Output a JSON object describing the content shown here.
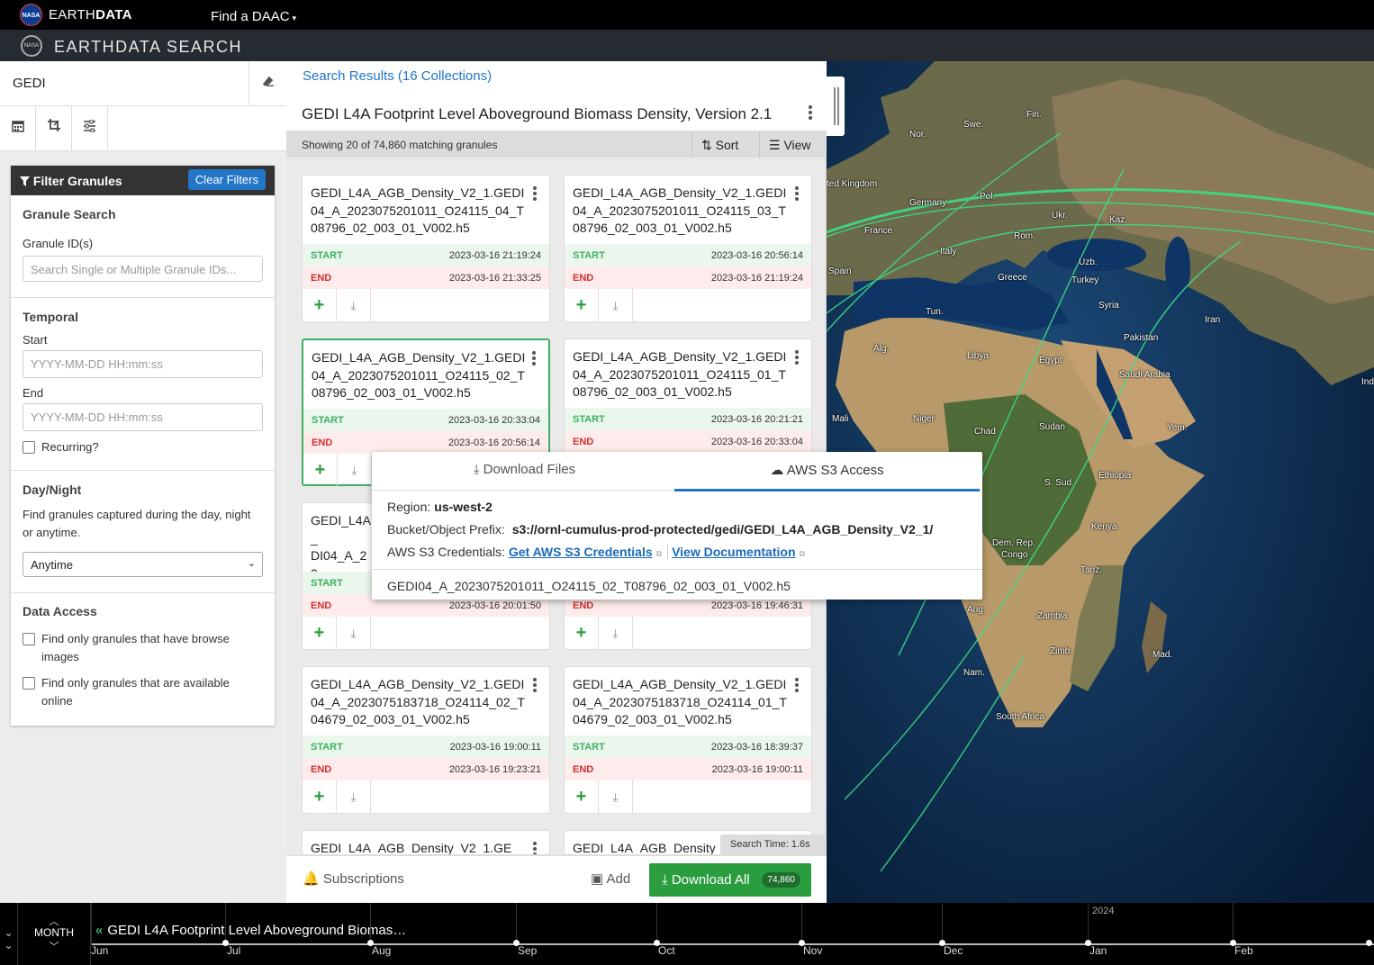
{
  "topbar": {
    "nasa_logo": "NASA",
    "earth": "EARTH",
    "data": "DATA",
    "find_daac": "Find a DAAC",
    "caret": "▾"
  },
  "appbar": {
    "logo": "NASA",
    "title": "EARTHDATA SEARCH"
  },
  "search": {
    "query": "GEDI",
    "clear_icon": "eraser-icon"
  },
  "sidebar_icons": [
    "calendar-icon",
    "crop-icon",
    "sliders-icon"
  ],
  "filter": {
    "header": "Filter Granules",
    "clear": "Clear Filters",
    "granule_search": {
      "title": "Granule Search",
      "label": "Granule ID(s)",
      "placeholder": "Search Single or Multiple Granule IDs..."
    },
    "temporal": {
      "title": "Temporal",
      "start_label": "Start",
      "start_placeholder": "YYYY-MM-DD HH:mm:ss",
      "end_label": "End",
      "end_placeholder": "YYYY-MM-DD HH:mm:ss",
      "recurring": "Recurring?"
    },
    "daynight": {
      "title": "Day/Night",
      "desc": "Find granules captured during the day, night or anytime.",
      "selected": "Anytime"
    },
    "access": {
      "title": "Data Access",
      "browse": "Find only granules that have browse images",
      "online": "Find only granules that are available online"
    }
  },
  "results": {
    "link": "Search Results (16 Collections)",
    "collection_title": "GEDI L4A Footprint Level Aboveground Biomass Density, Version 2.1",
    "showing": "Showing 20 of 74,860 matching granules",
    "sort": "Sort",
    "view": "View",
    "start_label": "START",
    "end_label": "END",
    "granules": [
      {
        "name": "GEDI_L4A_AGB_Density_V2_1.GEDI04_A_2023075201011_O24115_04_T08796_02_003_01_V002.h5",
        "start": "2023-03-16 21:19:24",
        "end": "2023-03-16 21:33:25"
      },
      {
        "name": "GEDI_L4A_AGB_Density_V2_1.GEDI04_A_2023075201011_O24115_03_T08796_02_003_01_V002.h5",
        "start": "2023-03-16 20:56:14",
        "end": "2023-03-16 21:19:24"
      },
      {
        "name": "GEDI_L4A_AGB_Density_V2_1.GEDI04_A_2023075201011_O24115_02_T08796_02_003_01_V002.h5",
        "start": "2023-03-16 20:33:04",
        "end": "2023-03-16 20:56:14"
      },
      {
        "name": "GEDI_L4A_AGB_Density_V2_1.GEDI04_A_2023075201011_O24115_01_T08796_02_003_01_V002.h5",
        "start": "2023-03-16 20:21:21",
        "end": "2023-03-16 20:33:04"
      },
      {
        "name": "GEDI_L4A_AGB_Density_V2_1.GEDI04_A_20",
        "name_line3": "4_T04679_",
        "start": "",
        "end": "2023-03-16 20:01:50"
      },
      {
        "name": "",
        "start": "",
        "end": "2023-03-16 19:46:31"
      },
      {
        "name": "GEDI_L4A_AGB_Density_V2_1.GEDI04_A_2023075183718_O24114_02_T04679_02_003_01_V002.h5",
        "start": "2023-03-16 19:00:11",
        "end": "2023-03-16 19:23:21"
      },
      {
        "name": "GEDI_L4A_AGB_Density_V2_1.GEDI04_A_2023075183718_O24114_01_T04679_02_003_01_V002.h5",
        "start": "2023-03-16 18:39:37",
        "end": "2023-03-16 19:00:11"
      },
      {
        "name": "GEDI_L4A_AGB_Density_V2_1.GE"
      },
      {
        "name": "GEDI_L4A_AGB_Density"
      }
    ],
    "search_time": "Search Time: 1.6s",
    "subscriptions": "Subscriptions",
    "add": "Add",
    "download_all": "Download All",
    "download_count": "74,860"
  },
  "popover": {
    "tab_download": "Download Files",
    "tab_s3": "AWS S3 Access",
    "region_label": "Region:",
    "region": "us-west-2",
    "bucket_label": "Bucket/Object Prefix:",
    "bucket": "s3://ornl-cumulus-prod-protected/gedi/GEDI_L4A_AGB_Density_V2_1/",
    "cred_label": "AWS S3 Credentials:",
    "cred_link": "Get AWS S3 Credentials",
    "doc_link": "View Documentation",
    "file": "GEDI04_A_2023075201011_O24115_02_T08796_02_003_01_V002.h5"
  },
  "map_labels": [
    "Fin.",
    "Swe.",
    "Nor.",
    "ted Kingdom",
    "Germany",
    "Pol.",
    "Ukr.",
    "Kaz.",
    "France",
    "Rom.",
    "Italy",
    "Uzb.",
    "Spain",
    "Greece",
    "Turkey",
    "Tun.",
    "Syria",
    "Iran",
    "Alg.",
    "Libya",
    "Egypt",
    "Pakistan",
    "Saudi Arabia",
    "Ind",
    "Mali",
    "Niger",
    "Chad",
    "Sudan",
    "Yem.",
    "Ethiopia",
    "S. Sud.",
    "Kenya",
    "Dem. Rep.",
    "Congo",
    "Tanz.",
    "Ang.",
    "Zambia",
    "Mad.",
    "Zimb.",
    "Nam.",
    "South Africa"
  ],
  "timeline": {
    "zoom_label": "MONTH",
    "collection": "GEDI L4A Footprint Level Aboveground Biomas…",
    "months": [
      "Jun",
      "Jul",
      "Aug",
      "Sep",
      "Oct",
      "Nov",
      "Dec",
      "Jan",
      "Feb"
    ],
    "year": "2024"
  },
  "colors": {
    "accent": "#2275c7",
    "green": "#3fb062",
    "red": "#d32f2f",
    "orbit": "#3ddc84"
  }
}
